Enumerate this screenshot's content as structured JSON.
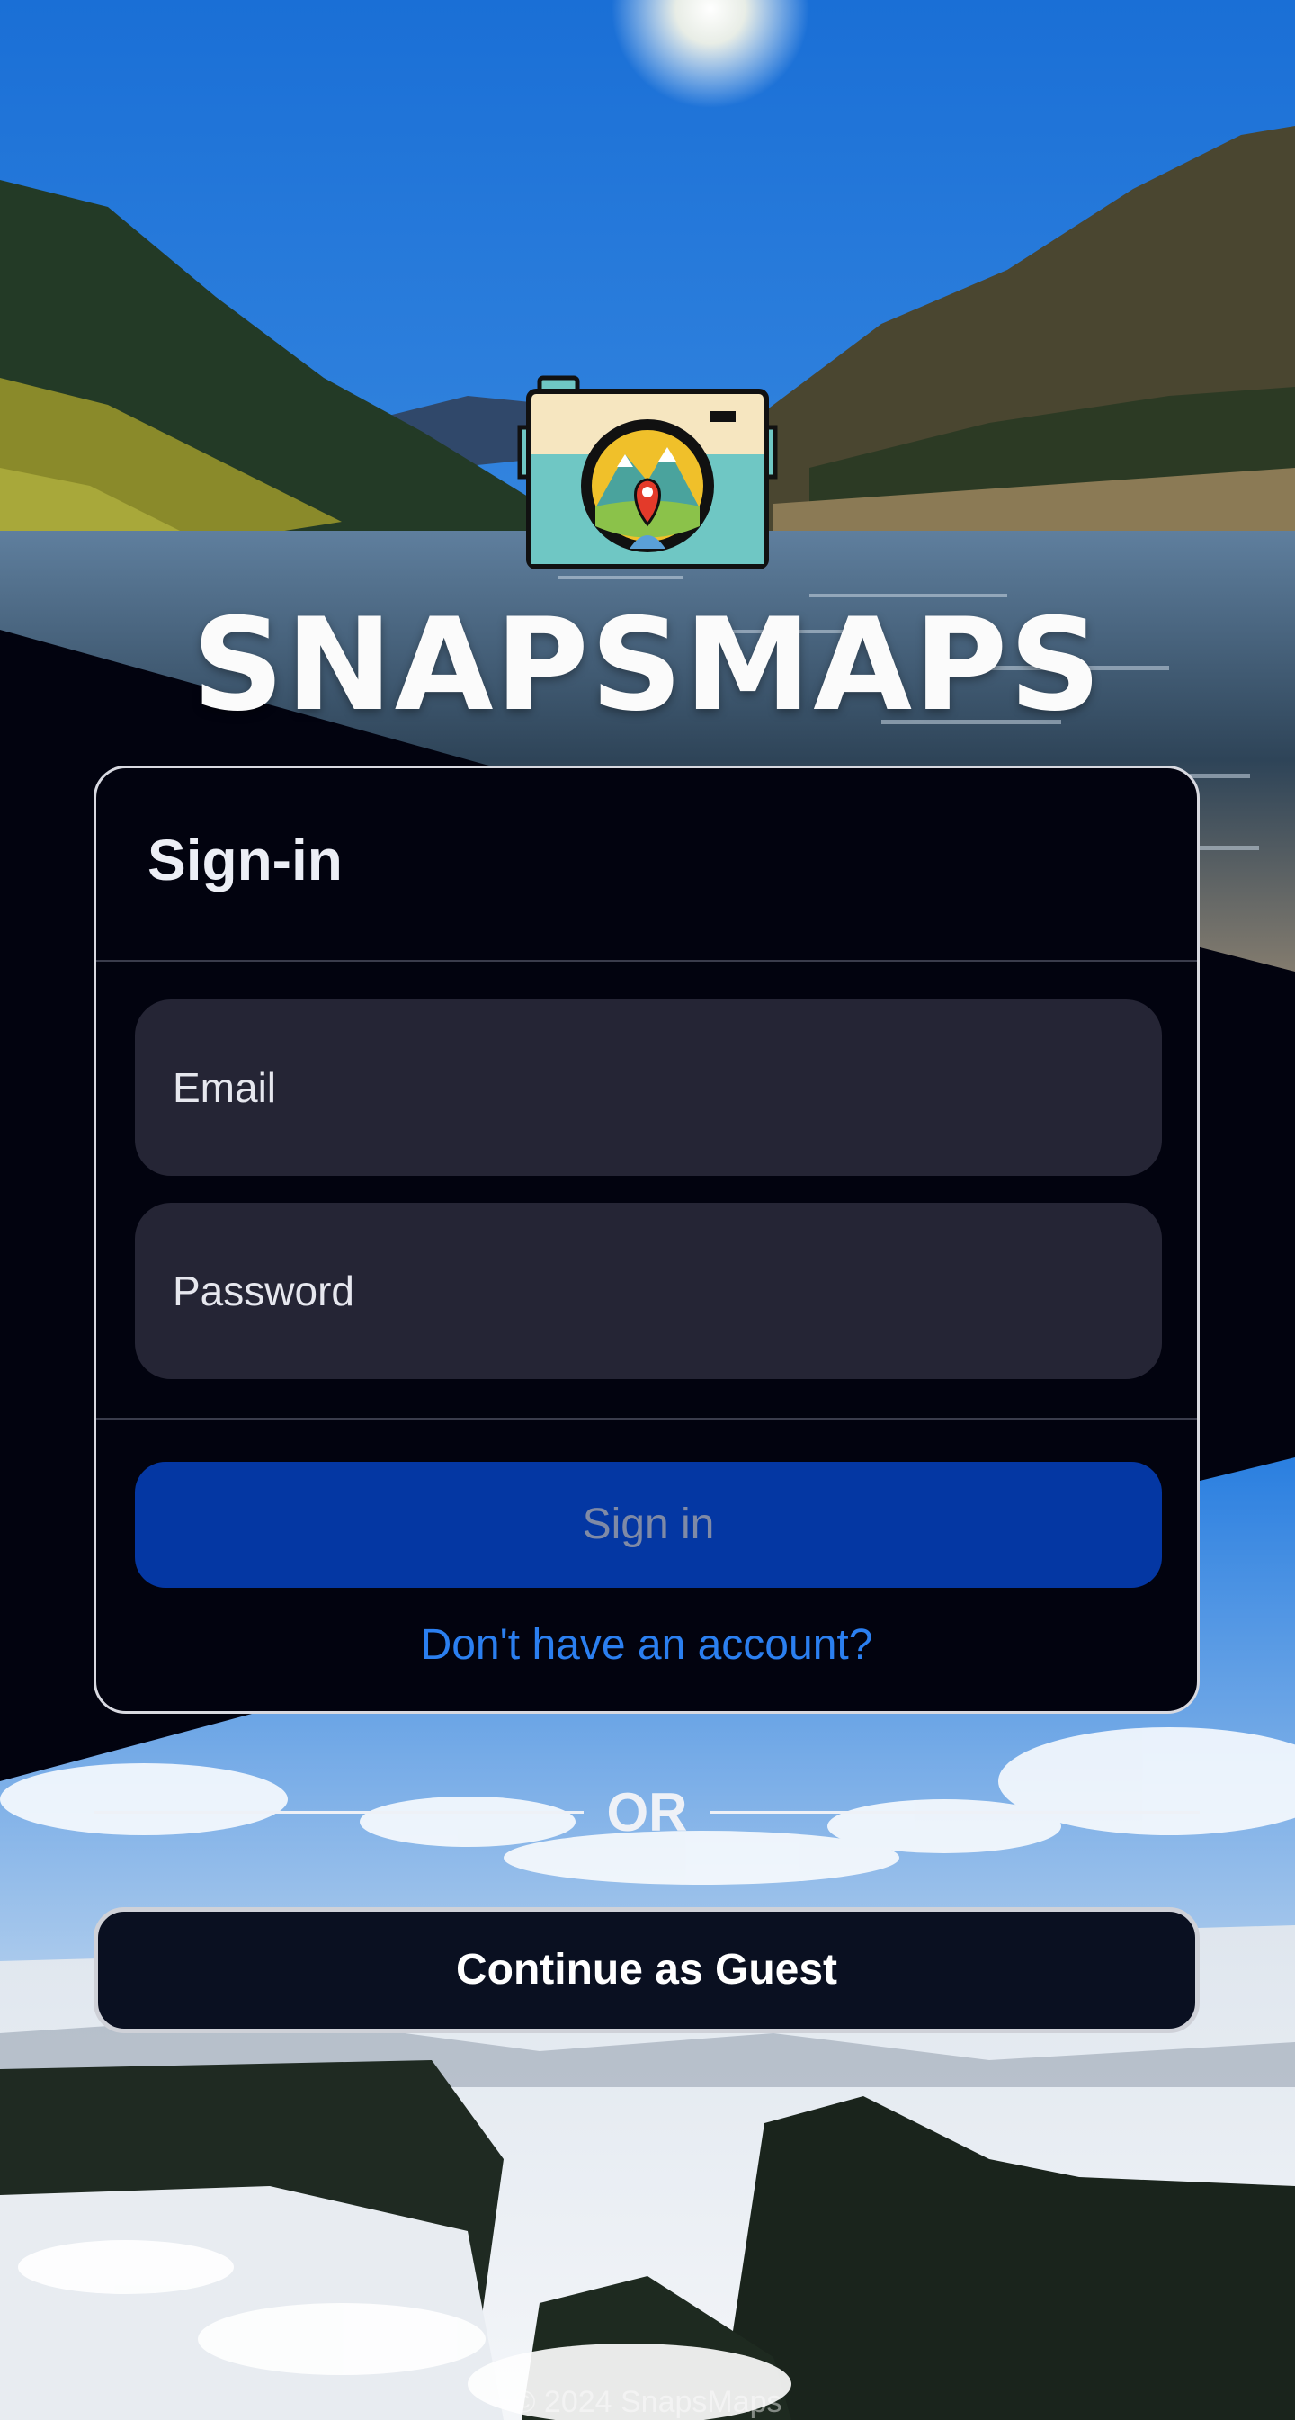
{
  "app": {
    "brand": "SNAPSMAPS"
  },
  "logo": {
    "icon": "camera-map-pin-icon"
  },
  "signin": {
    "title": "Sign-in",
    "email_placeholder": "Email",
    "password_placeholder": "Password",
    "submit_label": "Sign in",
    "register_link": "Don't have an account?"
  },
  "separator": {
    "label": "OR"
  },
  "guest": {
    "label": "Continue as Guest"
  },
  "footer": {
    "text": "© 2024 SnapsMaps"
  },
  "colors": {
    "background": "#02030f",
    "card": "#02030f",
    "field": "#252535",
    "primary": "#0437a3",
    "link": "#2b7ff0",
    "guest": "#0a1021"
  }
}
